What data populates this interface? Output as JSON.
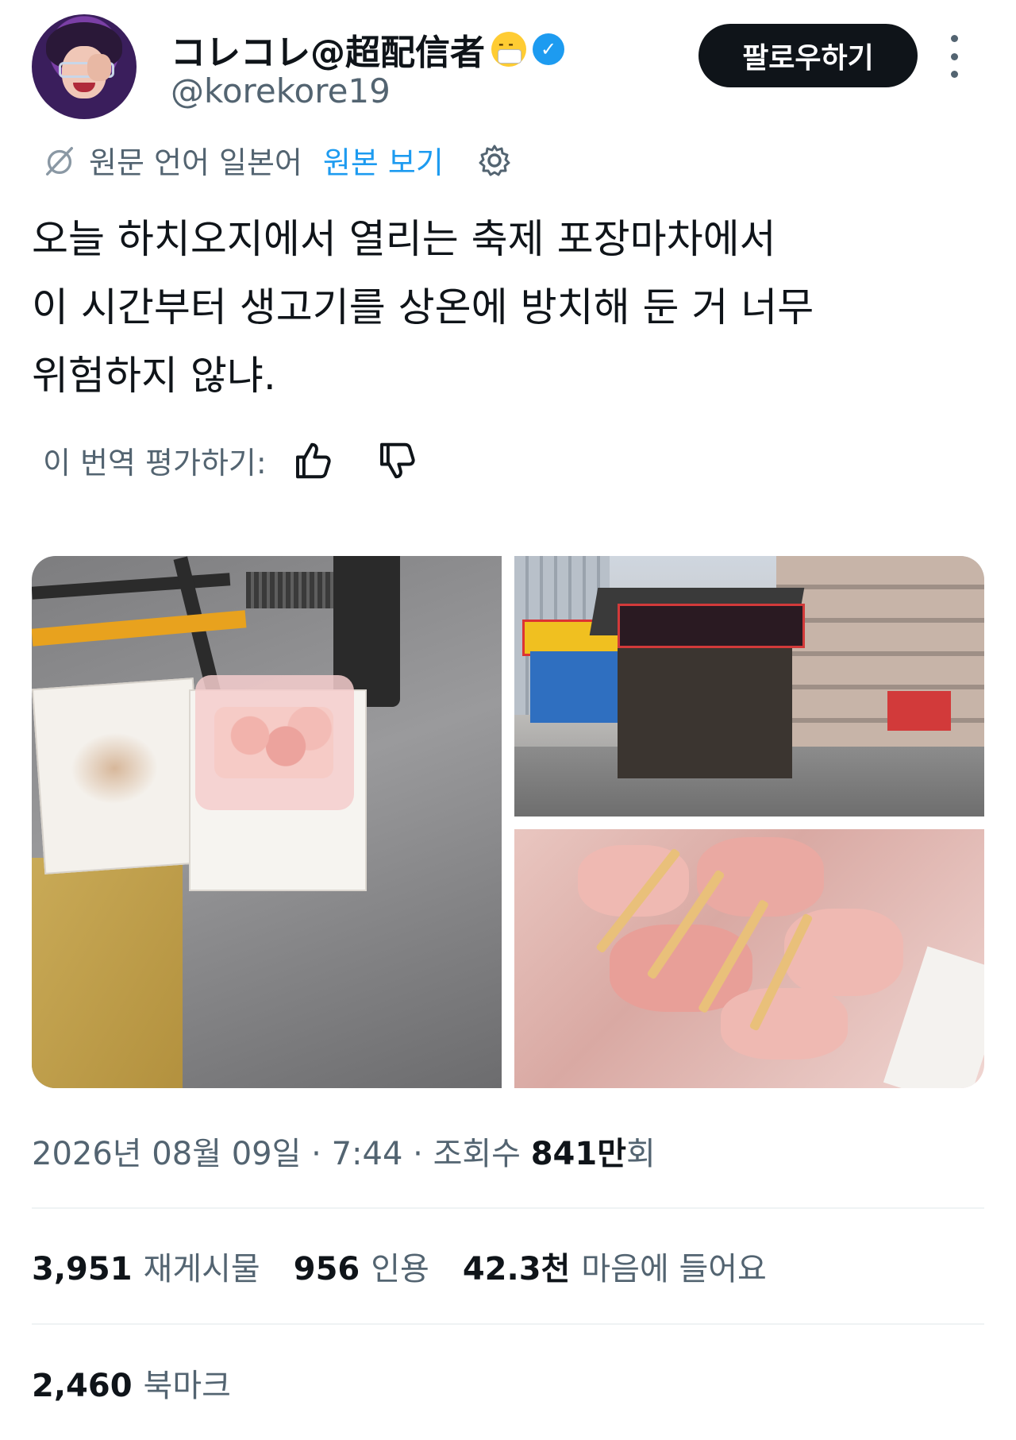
{
  "author": {
    "display_name": "コレコレ@超配信者",
    "handle": "@korekore19",
    "emoji": "mask-face-emoji",
    "verified": true,
    "follow_label": "팔로우하기"
  },
  "translation": {
    "source_label": "원문 언어 일본어",
    "view_original_label": "원본 보기",
    "rate_label": "이 번역 평가하기:"
  },
  "tweet": {
    "lines": [
      "오늘 하치오지에서 열리는 축제 포장마차에서",
      "이 시간부터 생고기를 상온에 방치해 둔 거 너무",
      "위험하지 않냐."
    ]
  },
  "media": {
    "count": 3,
    "images": [
      "styrofoam-box-with-raw-meat",
      "festival-food-stall",
      "raw-chicken-skewers-closeup"
    ]
  },
  "meta": {
    "date": "2026년 08월 09일",
    "time": "7:44",
    "views_label": "조회수",
    "views_value": "841만",
    "views_suffix": "회"
  },
  "stats": {
    "reposts_value": "3,951",
    "reposts_label": "재게시물",
    "quotes_value": "956",
    "quotes_label": "인용",
    "likes_value": "42.3천",
    "likes_label": "마음에 들어요",
    "bookmarks_value": "2,460",
    "bookmarks_label": "북마크"
  },
  "colors": {
    "accent": "#1d9bf0",
    "text_primary": "#0f1419",
    "text_secondary": "#536471",
    "button_bg": "#0f1419"
  }
}
